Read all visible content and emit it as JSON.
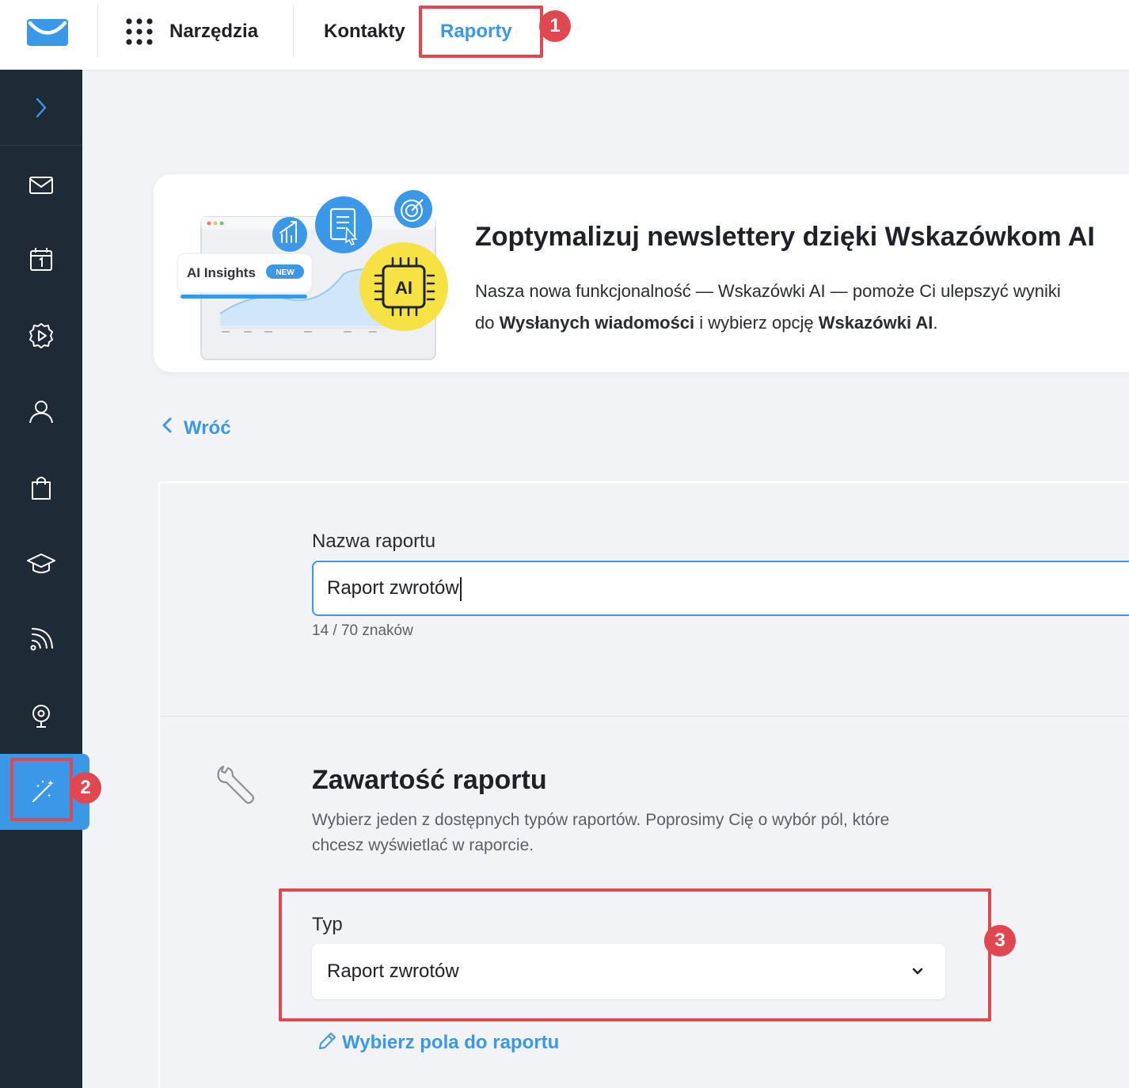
{
  "topbar": {
    "tools_label": "Narzędzia",
    "nav": [
      {
        "label": "Kontakty"
      },
      {
        "label": "Raporty"
      }
    ]
  },
  "callouts": [
    "1",
    "2",
    "3"
  ],
  "sidebar": {
    "items": [
      {
        "icon": "mail-icon"
      },
      {
        "icon": "calendar-icon"
      },
      {
        "icon": "automation-icon"
      },
      {
        "icon": "contacts-icon"
      },
      {
        "icon": "ecommerce-icon"
      },
      {
        "icon": "courses-icon"
      },
      {
        "icon": "rss-icon"
      },
      {
        "icon": "webinar-icon"
      },
      {
        "icon": "tools-magic-icon"
      }
    ],
    "active_index": 8
  },
  "promo": {
    "title": "Zoptymalizuj newslettery dzięki Wskazówkom AI",
    "line1": "Nasza nowa funkcjonalność — Wskazówki AI — pomoże Ci ulepszyć wyniki",
    "line2_pre": "do ",
    "line2_bold1": "Wysłanych wiadomości",
    "line2_mid": " i wybierz opcję ",
    "line2_bold2": "Wskazówki AI",
    "line2_post": ".",
    "illustration": {
      "chip_label": "AI Insights",
      "chip_badge": "NEW",
      "ai_badge": "AI"
    }
  },
  "back_label": "Wróć",
  "form": {
    "name_label": "Nazwa raportu",
    "name_value": "Raport zwrotów",
    "char_count": "14 / 70 znaków",
    "section_title": "Zawartość raportu",
    "section_desc": "Wybierz jeden z dostępnych typów raportów. Poprosimy Cię o wybór pól, które chcesz wyświetlać w raporcie.",
    "type_label": "Typ",
    "type_value": "Raport zwrotów",
    "fields_link": "Wybierz pola do raportu"
  },
  "colors": {
    "accent": "#3b97e8",
    "sidebar_bg": "#1e2a36",
    "callout": "#e0474f",
    "ai_yellow": "#f7e244"
  }
}
